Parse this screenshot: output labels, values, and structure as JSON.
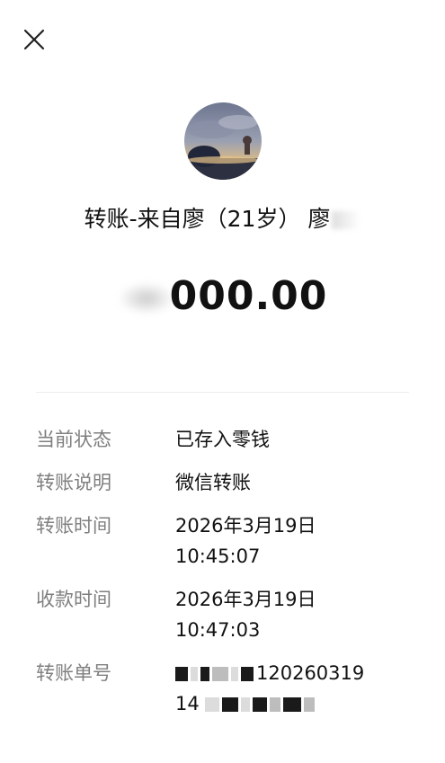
{
  "header": {
    "close_icon": "close-icon"
  },
  "avatar": {
    "icon": "avatar-image"
  },
  "transfer": {
    "title": "转账-来自廖（21岁） 廖",
    "amount_visible": "000.00"
  },
  "details": {
    "status_label": "当前状态",
    "status_value": "已存入零钱",
    "note_label": "转账说明",
    "note_value": "微信转账",
    "transfer_time_label": "转账时间",
    "transfer_time_line1": "2026年3月19日",
    "transfer_time_line2": "10:45:07",
    "receive_time_label": "收款时间",
    "receive_time_line1": "2026年3月19日",
    "receive_time_line2": "10:47:03",
    "order_label": "转账单号",
    "order_visible_part1": "120260319",
    "order_visible_part2": "14"
  },
  "colors": {
    "label": "#7f7f7f",
    "text": "#111111",
    "divider": "#ececec"
  }
}
